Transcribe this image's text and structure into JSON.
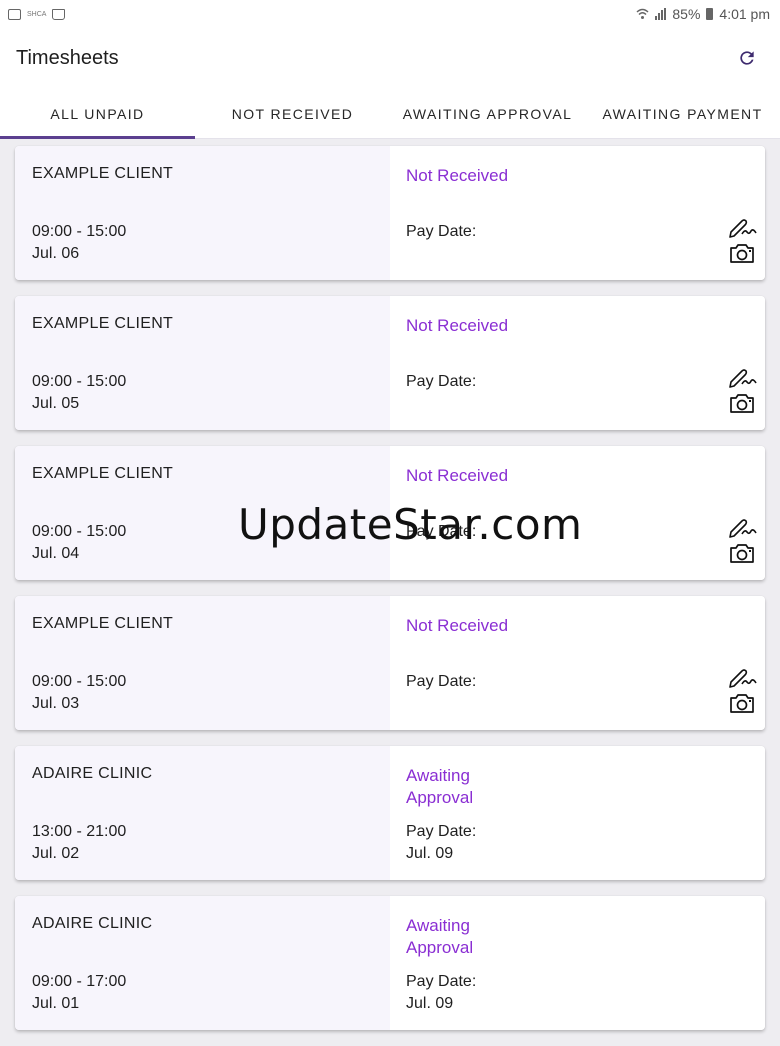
{
  "status_bar": {
    "left_text": "SHCA",
    "battery": "85%",
    "time": "4:01 pm"
  },
  "app_bar": {
    "title": "Timesheets",
    "refresh_icon": "refresh-icon"
  },
  "tabs": [
    {
      "label": "ALL UNPAID",
      "active": true
    },
    {
      "label": "NOT RECEIVED",
      "active": false
    },
    {
      "label": "AWAITING APPROVAL",
      "active": false
    },
    {
      "label": "AWAITING PAYMENT",
      "active": false
    }
  ],
  "timesheets": [
    {
      "client": "EXAMPLE CLIENT",
      "time": "09:00 - 15:00",
      "date": "Jul. 06",
      "status": "Not Received",
      "pay_date_label": "Pay Date:",
      "pay_date": "",
      "actions": [
        "sign-icon",
        "camera-icon"
      ]
    },
    {
      "client": "EXAMPLE CLIENT",
      "time": "09:00 - 15:00",
      "date": "Jul. 05",
      "status": "Not Received",
      "pay_date_label": "Pay Date:",
      "pay_date": "",
      "actions": [
        "sign-icon",
        "camera-icon"
      ]
    },
    {
      "client": "EXAMPLE CLIENT",
      "time": "09:00 - 15:00",
      "date": "Jul. 04",
      "status": "Not Received",
      "pay_date_label": "Pay Date:",
      "pay_date": "",
      "actions": [
        "sign-icon",
        "camera-icon"
      ]
    },
    {
      "client": "EXAMPLE CLIENT",
      "time": "09:00 - 15:00",
      "date": "Jul. 03",
      "status": "Not Received",
      "pay_date_label": "Pay Date:",
      "pay_date": "",
      "actions": [
        "sign-icon",
        "camera-icon"
      ]
    },
    {
      "client": "ADAIRE CLINIC",
      "time": "13:00 - 21:00",
      "date": "Jul. 02",
      "status": "Awaiting Approval",
      "pay_date_label": "Pay Date:",
      "pay_date": "Jul. 09",
      "actions": []
    },
    {
      "client": "ADAIRE CLINIC",
      "time": "09:00 - 17:00",
      "date": "Jul. 01",
      "status": "Awaiting Approval",
      "pay_date_label": "Pay Date:",
      "pay_date": "Jul. 09",
      "actions": []
    }
  ],
  "watermark": "UpdateStar.com",
  "colors": {
    "accent": "#5b3f8f",
    "status_text": "#8a2ed3",
    "card_left_bg": "#f7f5fc"
  }
}
